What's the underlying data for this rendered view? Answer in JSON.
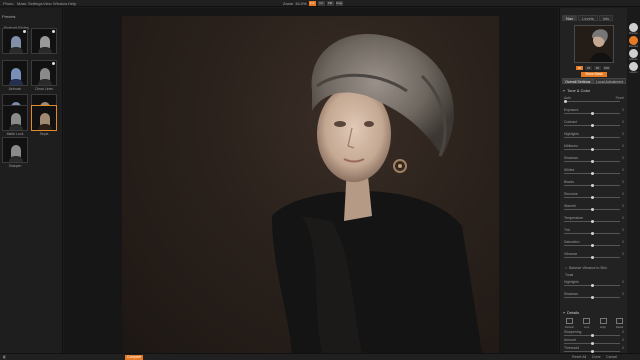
{
  "menu": [
    "Photo",
    "Mask",
    "Settings",
    "View",
    "Window",
    "Help"
  ],
  "zoom": {
    "label": "Zoom",
    "value": "34.0%",
    "options": [
      "1:1",
      "Fit",
      "Fill",
      "Crop"
    ]
  },
  "left_panel": {
    "header": "Presets",
    "category": "Portrait Styles",
    "presets": [
      {
        "name": "",
        "selected": false
      },
      {
        "name": "",
        "selected": false
      },
      {
        "name": "Airbrush",
        "selected": false
      },
      {
        "name": "Clean Lines",
        "selected": false
      },
      {
        "name": "Cool and Crisp",
        "selected": false
      },
      {
        "name": "Leather Tones",
        "selected": false
      },
      {
        "name": "Matte Look",
        "selected": false
      },
      {
        "name": "Sepia",
        "selected": true
      },
      {
        "name": "Sharpen",
        "selected": false
      }
    ],
    "search_placeholder": "Search"
  },
  "right_panel": {
    "tabs": [
      "Nav",
      "Levels",
      "Info"
    ],
    "nav_zoom": [
      "Fit",
      "25",
      "50",
      "100"
    ],
    "show_mask": "Show Mask",
    "settings_tabs": [
      "Overall Settings",
      "Local Adjustment"
    ],
    "tone_section": "Tone & Color",
    "sliders": [
      {
        "label": "Auto",
        "value": "Reset",
        "pos": 0.0
      },
      {
        "label": "Exposure",
        "value": "0",
        "pos": 0.5
      },
      {
        "label": "Contrast",
        "value": "0",
        "pos": 0.5
      },
      {
        "label": "Highlights",
        "value": "0",
        "pos": 0.5
      },
      {
        "label": "Midtones",
        "value": "0",
        "pos": 0.5
      },
      {
        "label": "Shadows",
        "value": "0",
        "pos": 0.5
      },
      {
        "label": "Whites",
        "value": "0",
        "pos": 0.5
      },
      {
        "label": "Blacks",
        "value": "0",
        "pos": 0.5
      },
      {
        "label": "Structure",
        "value": "0",
        "pos": 0.5
      },
      {
        "label": "Warmth",
        "value": "0",
        "pos": 0.5
      },
      {
        "label": "Temperature",
        "value": "0",
        "pos": 0.5
      },
      {
        "label": "Tint",
        "value": "0",
        "pos": 0.5
      },
      {
        "label": "Saturation",
        "value": "0",
        "pos": 0.5
      },
      {
        "label": "Vibrance",
        "value": "0",
        "pos": 0.5
      }
    ],
    "balance_label": "Balance Vibrance to Skin",
    "tonal_title": "Tonal",
    "tonal_sliders": [
      {
        "label": "Highlights",
        "value": "0",
        "pos": 0.5
      },
      {
        "label": "Shadows",
        "value": "0",
        "pos": 0.5
      }
    ],
    "details_section": "Details",
    "detail_modes": [
      "Default",
      "Low",
      "High",
      "Detail"
    ],
    "detail_sliders": [
      {
        "label": "Sharpening",
        "value": "0"
      },
      {
        "label": "Amount",
        "value": "0"
      },
      {
        "label": "Threshold",
        "value": "0"
      }
    ]
  },
  "toolstrip": [
    {
      "label": "Browse",
      "color": "#cfcfcf"
    },
    {
      "label": "Develop",
      "color": "#e57a22"
    },
    {
      "label": "Effects",
      "color": "#cfcfcf"
    },
    {
      "label": "Layers",
      "color": "#cfcfcf"
    }
  ],
  "bottom": {
    "left_btn": "Compare",
    "reset_all": "Reset All",
    "done": "Done",
    "cancel": "Cancel",
    "accent": "#e57a22"
  }
}
